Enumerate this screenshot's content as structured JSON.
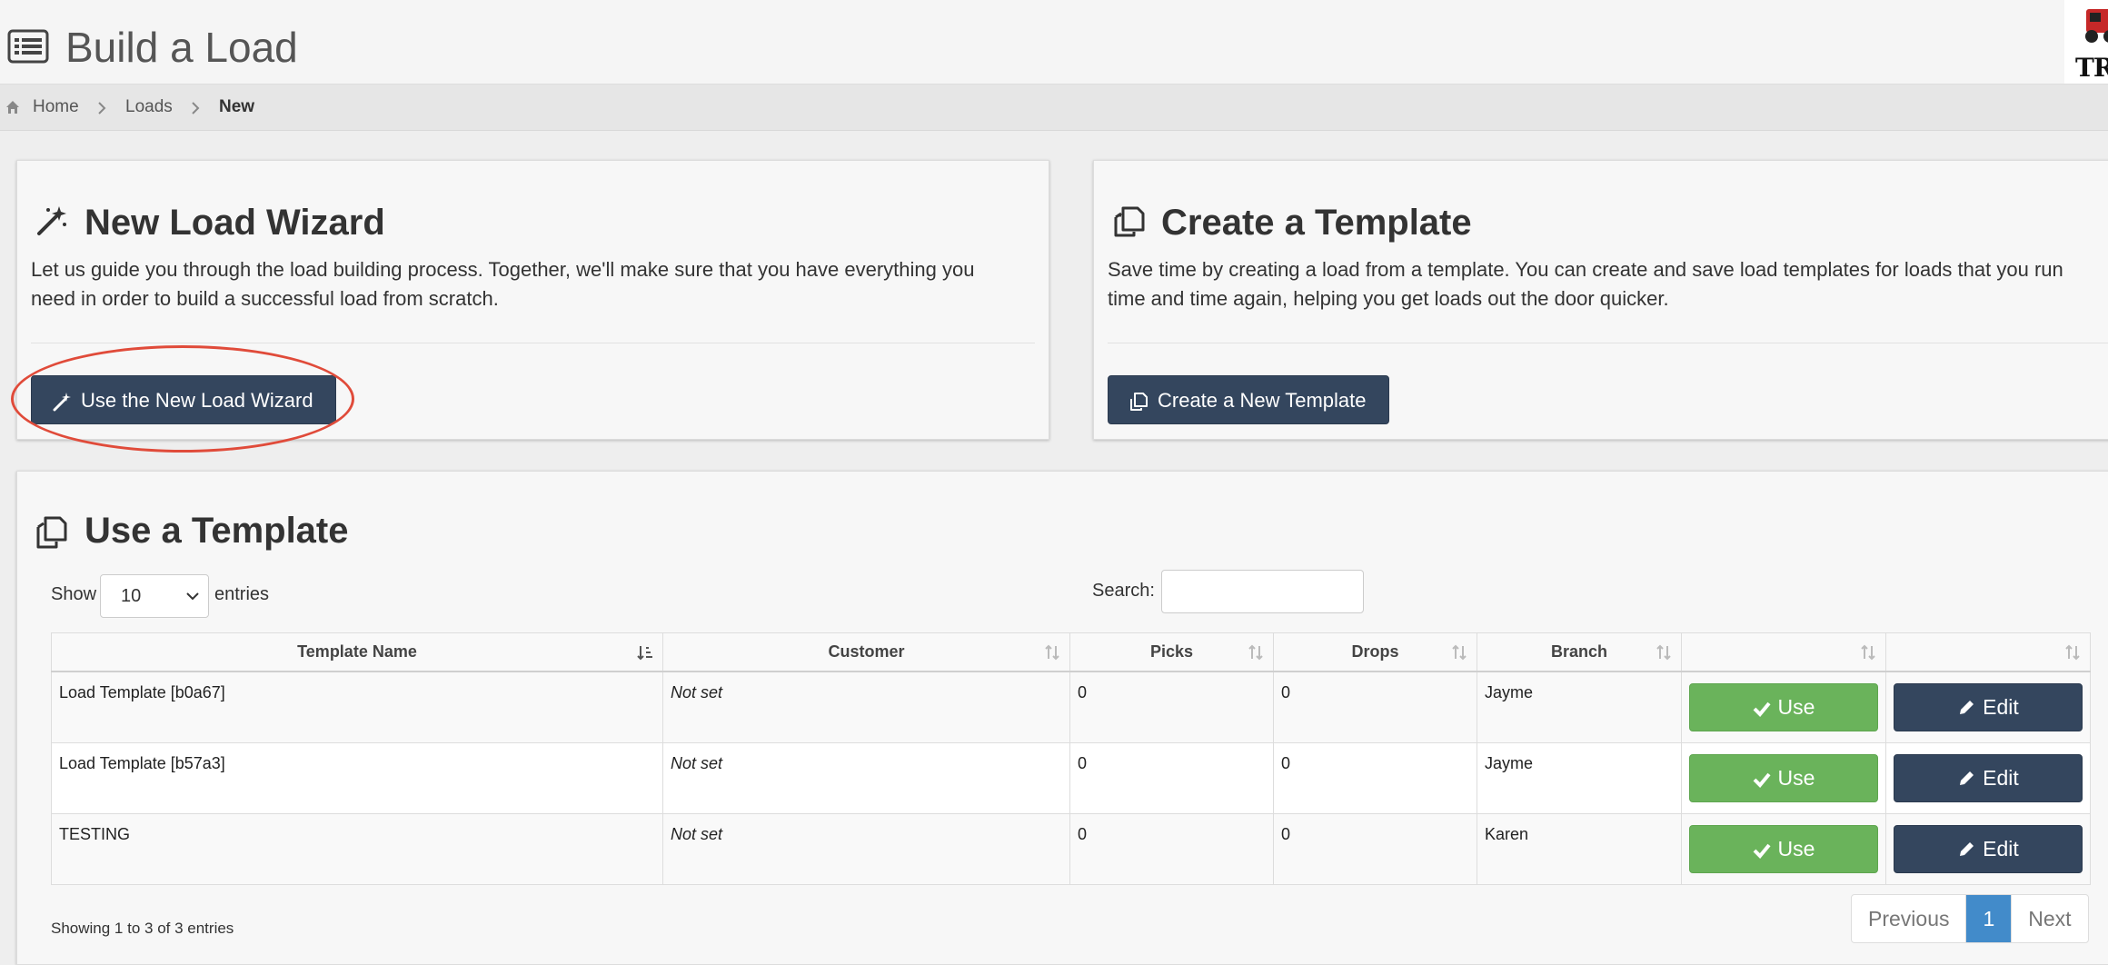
{
  "header": {
    "title": "Build a Load",
    "logo_text": "TR",
    "icon": "list-icon"
  },
  "breadcrumb": {
    "items": [
      "Home",
      "Loads",
      "New"
    ]
  },
  "wizard_panel": {
    "title": "New Load Wizard",
    "description": "Let us guide you through the load building process. Together, we'll make sure that you have everything you need in order to build a successful load from scratch.",
    "desc_line1": "Let us guide you through the load building process. Together, we'll make sure that you have everything you",
    "desc_line2": "need in order to build a successful load from scratch.",
    "button_label": "Use the New Load Wizard",
    "icon": "magic-wand-icon",
    "highlight_color": "#e04b3a"
  },
  "create_panel": {
    "title": "Create a Template",
    "desc_line1": "Save time by creating a load from a template. You can create and save load templates for loads that you run",
    "desc_line2": "time and time again, helping you get loads out the door quicker.",
    "button_label": "Create a New Template",
    "icon": "copy-icon"
  },
  "template_panel": {
    "title": "Use a Template",
    "show_label": "Show",
    "entries_label": "entries",
    "page_length": "10",
    "search_label": "Search:",
    "search_value": "",
    "columns": [
      "Template Name",
      "Customer",
      "Picks",
      "Drops",
      "Branch",
      "",
      ""
    ],
    "rows": [
      {
        "name": "Load Template [b0a67]",
        "customer": "Not set",
        "picks": "0",
        "drops": "0",
        "branch": "Jayme",
        "use": "Use",
        "edit": "Edit"
      },
      {
        "name": "Load Template [b57a3]",
        "customer": "Not set",
        "picks": "0",
        "drops": "0",
        "branch": "Jayme",
        "use": "Use",
        "edit": "Edit"
      },
      {
        "name": "TESTING",
        "customer": "Not set",
        "picks": "0",
        "drops": "0",
        "branch": "Karen",
        "use": "Use",
        "edit": "Edit"
      }
    ],
    "info": "Showing 1 to 3 of 3 entries",
    "pagination": {
      "previous": "Previous",
      "current": "1",
      "next": "Next"
    }
  },
  "colors": {
    "primary_dark": "#34465e",
    "success": "#6ab35b",
    "page_active": "#428bca"
  }
}
